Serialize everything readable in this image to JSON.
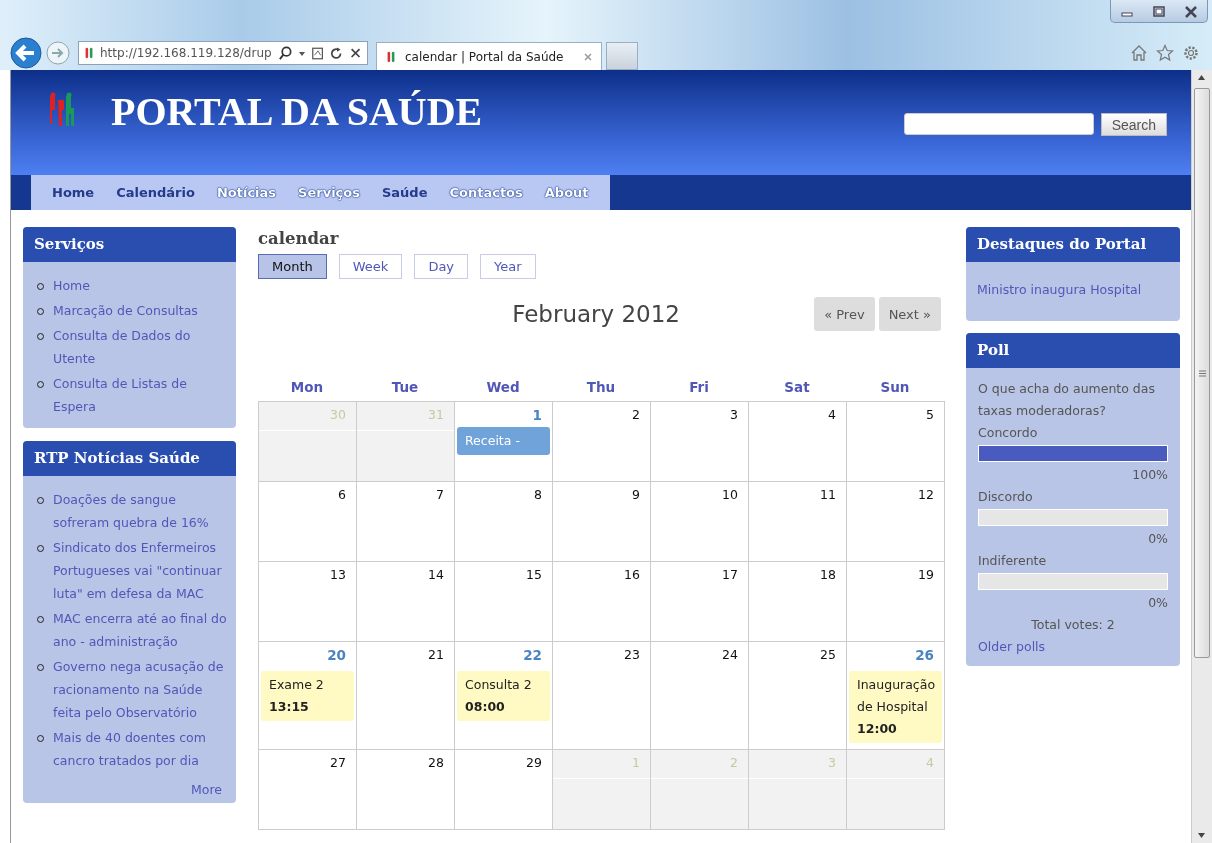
{
  "browser": {
    "address": "http://192.168.119.128/drup",
    "tab_title": "calendar | Portal da Saúde"
  },
  "site": {
    "title": "PORTAL DA SAÚDE",
    "search_button": "Search"
  },
  "nav": [
    {
      "label": "Home",
      "kind": "plain"
    },
    {
      "label": "Calendário",
      "kind": "plain"
    },
    {
      "label": "Notícias",
      "kind": "faded"
    },
    {
      "label": "Serviços",
      "kind": "faded"
    },
    {
      "label": "Saúde",
      "kind": "plain"
    },
    {
      "label": "Contactos",
      "kind": "faded"
    },
    {
      "label": "About",
      "kind": "faded"
    }
  ],
  "left_blocks": [
    {
      "title": "Serviços",
      "items": [
        "Home",
        "Marcação de Consultas",
        "Consulta de Dados do Utente",
        "Consulta de Listas de Espera"
      ]
    },
    {
      "title": "RTP Notícias Saúde",
      "items": [
        "Doações de sangue sofreram quebra de 16%",
        "Sindicato dos Enfermeiros Portugueses vai \"continuar luta\" em defesa da MAC",
        "MAC encerra até ao final do ano - administração",
        "Governo nega acusação de racionamento na Saúde feita pelo Observatório",
        "Mais de 40 doentes com cancro tratados por dia"
      ],
      "more": "More"
    }
  ],
  "calendar": {
    "title": "calendar",
    "views": [
      {
        "label": "Month",
        "selected": true
      },
      {
        "label": "Week",
        "selected": false
      },
      {
        "label": "Day",
        "selected": false
      },
      {
        "label": "Year",
        "selected": false
      }
    ],
    "month": "February 2012",
    "prev": "« Prev",
    "next": "Next »",
    "weekdays": [
      "Mon",
      "Tue",
      "Wed",
      "Thu",
      "Fri",
      "Sat",
      "Sun"
    ],
    "weeks": [
      [
        {
          "day": "30",
          "other_month": true
        },
        {
          "day": "31",
          "other_month": true
        },
        {
          "day": "1",
          "other_month": false,
          "events": [
            {
              "title": "Receita -",
              "color": "#6fa3d9"
            }
          ]
        },
        {
          "day": "2",
          "other_month": false
        },
        {
          "day": "3",
          "other_month": false
        },
        {
          "day": "4",
          "other_month": false
        },
        {
          "day": "5",
          "other_month": false
        }
      ],
      [
        {
          "day": "6",
          "other_month": false
        },
        {
          "day": "7",
          "other_month": false
        },
        {
          "day": "8",
          "other_month": false
        },
        {
          "day": "9",
          "other_month": false
        },
        {
          "day": "10",
          "other_month": false
        },
        {
          "day": "11",
          "other_month": false
        },
        {
          "day": "12",
          "other_month": false
        }
      ],
      [
        {
          "day": "13",
          "other_month": false
        },
        {
          "day": "14",
          "other_month": false
        },
        {
          "day": "15",
          "other_month": false
        },
        {
          "day": "16",
          "other_month": false
        },
        {
          "day": "17",
          "other_month": false
        },
        {
          "day": "18",
          "other_month": false
        },
        {
          "day": "19",
          "other_month": false
        }
      ],
      [
        {
          "day": "20",
          "other_month": false,
          "events": [
            {
              "title": "Exame 2",
              "time": "13:15",
              "color": "#fff9c4"
            }
          ]
        },
        {
          "day": "21",
          "other_month": false
        },
        {
          "day": "22",
          "other_month": false,
          "events": [
            {
              "title": "Consulta 2",
              "time": "08:00",
              "color": "#fff9c4"
            }
          ]
        },
        {
          "day": "23",
          "other_month": false
        },
        {
          "day": "24",
          "other_month": false
        },
        {
          "day": "25",
          "other_month": false
        },
        {
          "day": "26",
          "other_month": false,
          "events": [
            {
              "title": "Inauguração de Hospital",
              "time": "12:00",
              "color": "#fff9c4"
            }
          ]
        }
      ],
      [
        {
          "day": "27",
          "other_month": false
        },
        {
          "day": "28",
          "other_month": false
        },
        {
          "day": "29",
          "other_month": false
        },
        {
          "day": "1",
          "other_month": true
        },
        {
          "day": "2",
          "other_month": true
        },
        {
          "day": "3",
          "other_month": true
        },
        {
          "day": "4",
          "other_month": true
        }
      ]
    ]
  },
  "right_blocks": {
    "highlights": {
      "title": "Destaques do Portal",
      "link": "Ministro inaugura Hospital"
    },
    "poll": {
      "title": "Poll",
      "question": "O que acha do aumento das taxas moderadoras?",
      "choices": [
        {
          "label": "Concordo",
          "level": 1,
          "percent": "100%"
        },
        {
          "label": "Discordo",
          "level": 0,
          "percent": "0%"
        },
        {
          "label": "Indiferente",
          "level": 0,
          "percent": "0%"
        }
      ],
      "total": "Total votes: 2",
      "older": "Older polls"
    }
  }
}
